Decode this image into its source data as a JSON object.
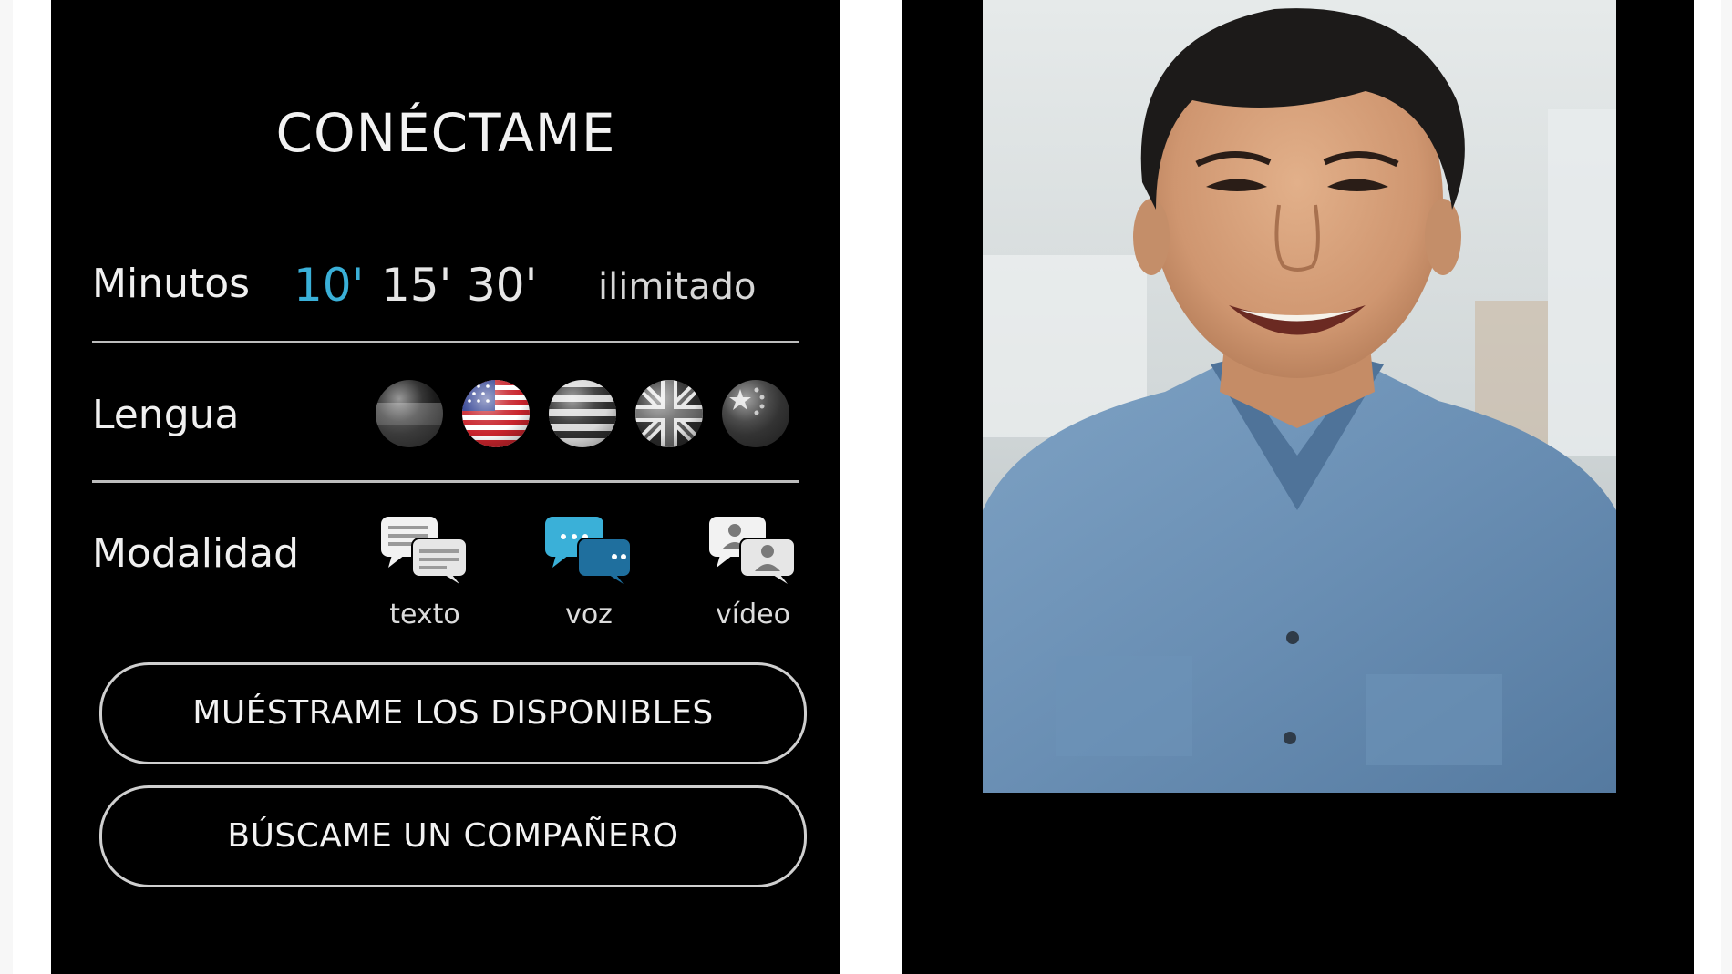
{
  "app": {
    "title": "CONÉCTAME"
  },
  "minutes": {
    "label": "Minutos",
    "options": [
      "10'",
      "15'",
      "30'"
    ],
    "unlimited": "ilimitado",
    "selected": "10'"
  },
  "language": {
    "label": "Lengua",
    "flags": [
      "germany-flag-icon",
      "usa-flag-icon",
      "flag-icon",
      "uk-flag-icon",
      "china-flag-icon"
    ]
  },
  "modality": {
    "label": "Modalidad",
    "options": [
      {
        "label": "texto",
        "icon": "text-chat-icon"
      },
      {
        "label": "voz",
        "icon": "voice-chat-icon"
      },
      {
        "label": "vídeo",
        "icon": "video-chat-icon"
      }
    ],
    "selected": "voz"
  },
  "buttons": {
    "show_available": "MUÉSTRAME LOS DISPONIBLES",
    "find_partner": "BÚSCAME UN COMPAÑERO"
  },
  "colors": {
    "accent": "#3ab0d8",
    "background": "#000000",
    "text": "#f0f0f0"
  }
}
